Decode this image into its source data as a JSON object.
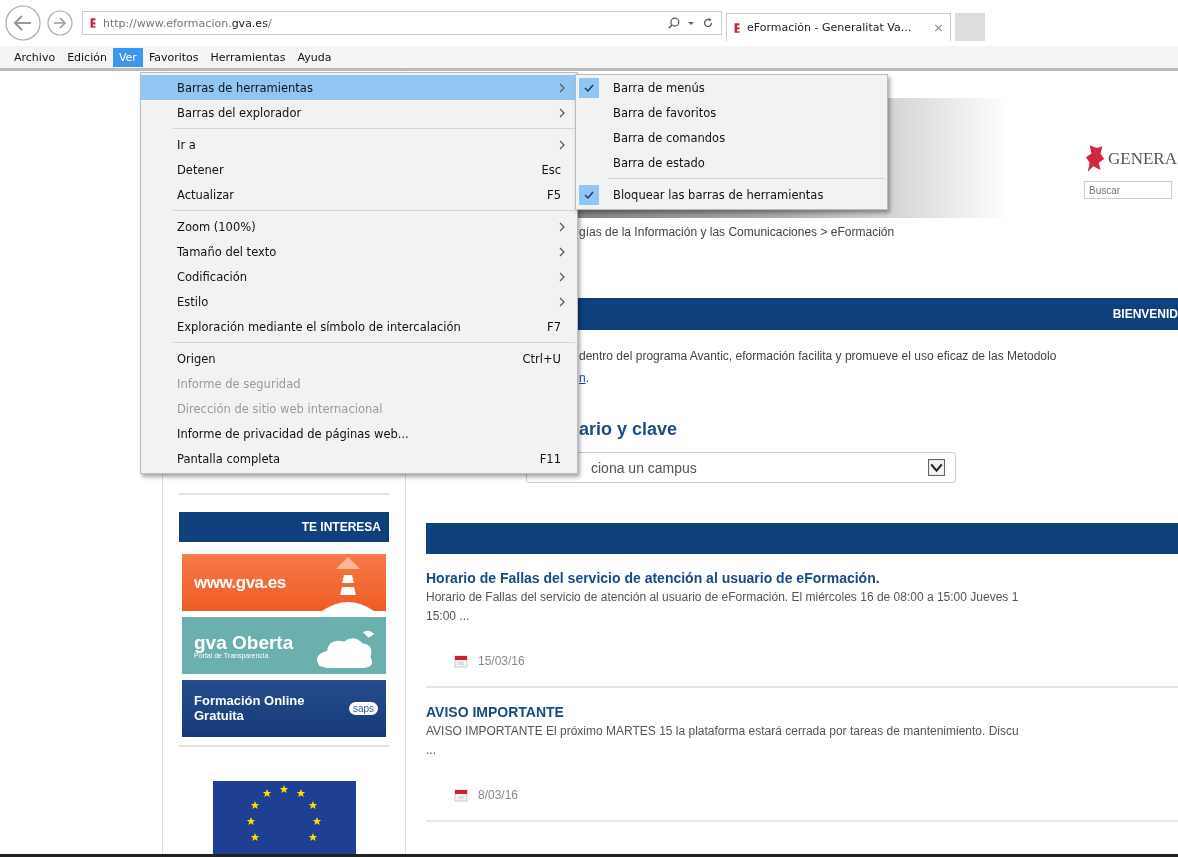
{
  "browser": {
    "address": "http://www.eformacion.**gva.es**/",
    "tab": {
      "title": "eFormación - Generalitat Va...",
      "close": "×"
    }
  },
  "menubar": [
    {
      "label": "Archivo",
      "selected": false
    },
    {
      "label": "Edición",
      "selected": false
    },
    {
      "label": "Ver",
      "selected": true
    },
    {
      "label": "Favoritos",
      "selected": false
    },
    {
      "label": "Herramientas",
      "selected": false
    },
    {
      "label": "Ayuda",
      "selected": false
    }
  ],
  "menu": [
    {
      "kind": "item",
      "label": "Barras de herramientas",
      "submenu": true,
      "selected": true,
      "disabled": false
    },
    {
      "kind": "item",
      "label": "Barras del explorador",
      "submenu": true,
      "selected": false,
      "disabled": false
    },
    {
      "kind": "separator"
    },
    {
      "kind": "item",
      "label": "Ir a",
      "submenu": true,
      "selected": false,
      "disabled": false
    },
    {
      "kind": "item",
      "label": "Detener",
      "shortcut": "Esc",
      "submenu": false,
      "selected": false,
      "disabled": false
    },
    {
      "kind": "item",
      "label": "Actualizar",
      "shortcut": "F5",
      "submenu": false,
      "selected": false,
      "disabled": false
    },
    {
      "kind": "separator"
    },
    {
      "kind": "item",
      "label": "Zoom (100%)",
      "submenu": true,
      "selected": false,
      "disabled": false
    },
    {
      "kind": "item",
      "label": "Tamaño del texto",
      "submenu": true,
      "selected": false,
      "disabled": false
    },
    {
      "kind": "item",
      "label": "Codificación",
      "submenu": true,
      "selected": false,
      "disabled": false
    },
    {
      "kind": "item",
      "label": "Estilo",
      "submenu": true,
      "selected": false,
      "disabled": false
    },
    {
      "kind": "item",
      "label": "Exploración mediante el símbolo de intercalación",
      "shortcut": "F7",
      "submenu": false,
      "selected": false,
      "disabled": false
    },
    {
      "kind": "separator"
    },
    {
      "kind": "item",
      "label": "Origen",
      "shortcut": "Ctrl+U",
      "submenu": false,
      "selected": false,
      "disabled": false
    },
    {
      "kind": "item",
      "label": "Informe de seguridad",
      "submenu": false,
      "selected": false,
      "disabled": true
    },
    {
      "kind": "item",
      "label": "Dirección de sitio web internacional",
      "submenu": false,
      "selected": false,
      "disabled": true
    },
    {
      "kind": "item",
      "label": "Informe de privacidad de páginas web...",
      "submenu": false,
      "selected": false,
      "disabled": false
    },
    {
      "kind": "item",
      "label": "Pantalla completa",
      "shortcut": "F11",
      "submenu": false,
      "selected": false,
      "disabled": false
    }
  ],
  "submenu": [
    {
      "kind": "item",
      "label": "Barra de menús",
      "checked": true
    },
    {
      "kind": "item",
      "label": "Barra de favoritos",
      "checked": false
    },
    {
      "kind": "item",
      "label": "Barra de comandos",
      "checked": false
    },
    {
      "kind": "item",
      "label": "Barra de estado",
      "checked": false
    },
    {
      "kind": "separator"
    },
    {
      "kind": "item",
      "label": "Bloquear las barras de herramientas",
      "checked": true
    }
  ],
  "page": {
    "logo_text": "GENERA",
    "search": {
      "placeholder": "Buscar"
    },
    "breadcrumb": "gías de la Información y las Comunicaciones > eFormación",
    "welcome_bar": "BIENVENID",
    "intro": {
      "text": "dentro del programa Avantic, eformación facilita y promueve el uso eficaz de las Metodolo",
      "link": "n",
      "tail": "."
    },
    "login_heading": "ario y clave",
    "campus_select": {
      "value": "ciona un campus"
    },
    "sidebar": {
      "title": "TE INTERESA",
      "banners": [
        {
          "kind": "gva",
          "text": "www.gva.es"
        },
        {
          "kind": "oberta",
          "text": "gva Oberta",
          "subtext": "Portal de Transparencia"
        },
        {
          "kind": "saps",
          "text": "Formación Online Gratuita",
          "subtext": "saps"
        }
      ]
    },
    "news": [
      {
        "title": "Horario de Fallas del servicio de atención al usuario de eFormación.",
        "summary": [
          "Horario de Fallas del servicio de atención al usuario de eFormación. El miércoles 16 de 08:00 a 15:00  Jueves 1",
          "15:00  ..."
        ],
        "date": "15/03/16"
      },
      {
        "title": "AVISO IMPORTANTE",
        "summary": [
          "AVISO IMPORTANTE   El próximo MARTES 15 la plataforma estará cerrada por tareas de mantenimiento. Discu",
          "  ..."
        ],
        "date": "8/03/16"
      }
    ]
  }
}
